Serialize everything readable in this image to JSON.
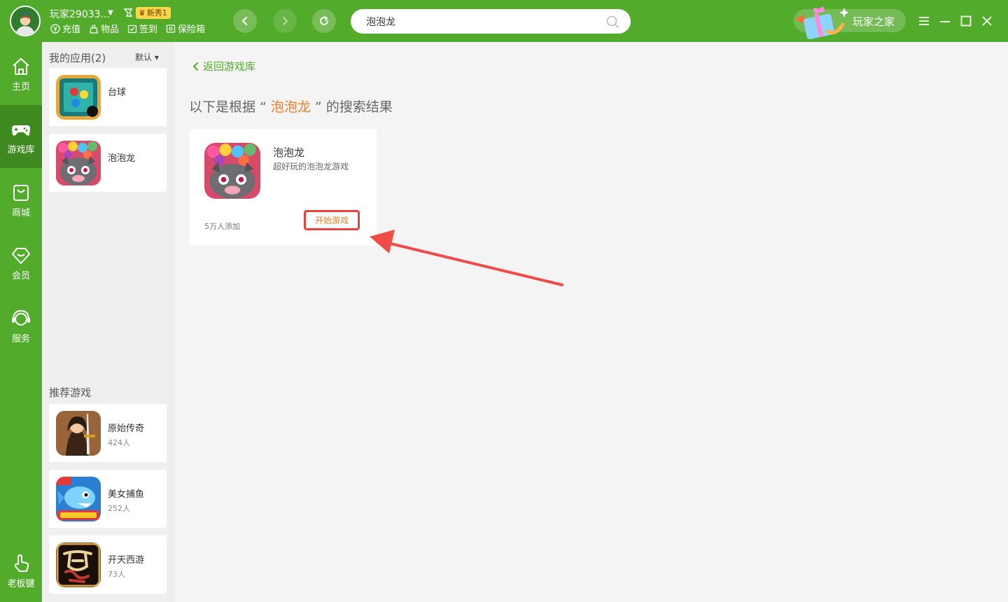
{
  "user": {
    "name": "玩家29033...",
    "badge": "新秀1"
  },
  "quick_links": [
    {
      "label": "充值",
      "icon": "yuan-coin-icon"
    },
    {
      "label": "物品",
      "icon": "bag-icon"
    },
    {
      "label": "签到",
      "icon": "checkin-icon"
    },
    {
      "label": "保险箱",
      "icon": "safe-box-icon"
    }
  ],
  "search": {
    "value": "泡泡龙",
    "placeholder": ""
  },
  "player_home": {
    "label": "玩家之家"
  },
  "sidebar": {
    "items": [
      {
        "label": "主页",
        "icon": "home-icon"
      },
      {
        "label": "游戏库",
        "icon": "gamepad-icon",
        "active": true
      },
      {
        "label": "商城",
        "icon": "shopping-bag-icon"
      },
      {
        "label": "会员",
        "icon": "diamond-icon"
      },
      {
        "label": "服务",
        "icon": "headset-icon"
      },
      {
        "label": "老板键",
        "icon": "hand-pointer-icon"
      }
    ]
  },
  "my_apps": {
    "title": "我的应用(2)",
    "sort": "默认",
    "items": [
      {
        "name": "台球"
      },
      {
        "name": "泡泡龙"
      }
    ]
  },
  "recommended": {
    "title": "推荐游戏",
    "items": [
      {
        "name": "原始传奇",
        "players": "424人"
      },
      {
        "name": "美女捕鱼",
        "players": "252人"
      },
      {
        "name": "开天西游",
        "players": "73人"
      }
    ]
  },
  "main": {
    "back_label": "返回游戏库",
    "heading_prefix": "以下是根据 “",
    "heading_keyword": "泡泡龙",
    "heading_suffix": "” 的搜索结果",
    "result": {
      "title": "泡泡龙",
      "desc": "超好玩的泡泡龙游戏",
      "added": "5万人添加",
      "button": "开始游戏"
    }
  },
  "colors": {
    "brand_green": "#52ab2b",
    "sidebar_active": "#3f8a20",
    "keyword_orange": "#f07c26",
    "annotation_red": "#e5433b"
  }
}
